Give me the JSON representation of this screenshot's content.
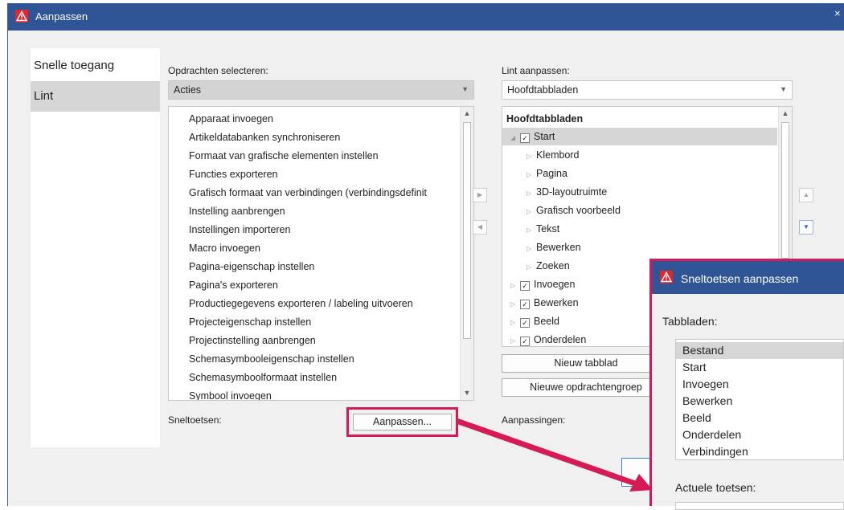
{
  "window": {
    "title": "Aanpassen",
    "close_glyph": "×",
    "app_icon": "warning-triangle-icon"
  },
  "sidebar": {
    "items": [
      {
        "label": "Snelle toegang"
      },
      {
        "label": "Lint"
      }
    ],
    "selected": "Lint"
  },
  "left_panel": {
    "label": "Opdrachten selecteren:",
    "combo_value": "Acties",
    "commands": [
      "Apparaat invoegen",
      "Artikeldatabanken synchroniseren",
      "Formaat van grafische elementen instellen",
      "Functies exporteren",
      "Grafisch formaat van verbindingen (verbindingsdefinit",
      "Instelling aanbrengen",
      "Instellingen importeren",
      "Macro invoegen",
      "Pagina-eigenschap instellen",
      "Pagina's exporteren",
      "Productiegegevens exporteren / labeling uitvoeren",
      "Projecteigenschap instellen",
      "Projectinstelling aanbrengen",
      "Schemasymbooleigenschap instellen",
      "Schemasymboolformaat instellen",
      "Symbool invoegen"
    ],
    "shortcuts_label": "Sneltoetsen:",
    "customize_button": "Aanpassen..."
  },
  "right_panel": {
    "label": "Lint aanpassen:",
    "combo_value": "Hoofdtabbladen",
    "tree_header": "Hoofdtabbladen",
    "tree": [
      {
        "label": "Start",
        "level": 0,
        "checked": true,
        "expanded": true,
        "selected": true
      },
      {
        "label": "Klembord",
        "level": 1
      },
      {
        "label": "Pagina",
        "level": 1
      },
      {
        "label": "3D-layoutruimte",
        "level": 1
      },
      {
        "label": "Grafisch voorbeeld",
        "level": 1
      },
      {
        "label": "Tekst",
        "level": 1
      },
      {
        "label": "Bewerken",
        "level": 1
      },
      {
        "label": "Zoeken",
        "level": 1
      },
      {
        "label": "Invoegen",
        "level": 0,
        "checked": true
      },
      {
        "label": "Bewerken",
        "level": 0,
        "checked": true
      },
      {
        "label": "Beeld",
        "level": 0,
        "checked": true
      },
      {
        "label": "Onderdelen",
        "level": 0,
        "checked": true
      }
    ],
    "new_tab_button": "Nieuw tabblad",
    "new_group_button": "Nieuwe opdrachtengroep",
    "customizations_label": "Aanpassingen:"
  },
  "popup": {
    "title": "Sneltoetsen aanpassen",
    "tabs_label": "Tabbladen:",
    "tabs": [
      "Bestand",
      "Start",
      "Invoegen",
      "Bewerken",
      "Beeld",
      "Onderdelen",
      "Verbindingen"
    ],
    "selected_tab": "Bestand",
    "current_keys_label": "Actuele toetsen:"
  },
  "colors": {
    "titlebar": "#2f5597",
    "highlight": "#d61a55",
    "icon_red": "#e2262e"
  }
}
